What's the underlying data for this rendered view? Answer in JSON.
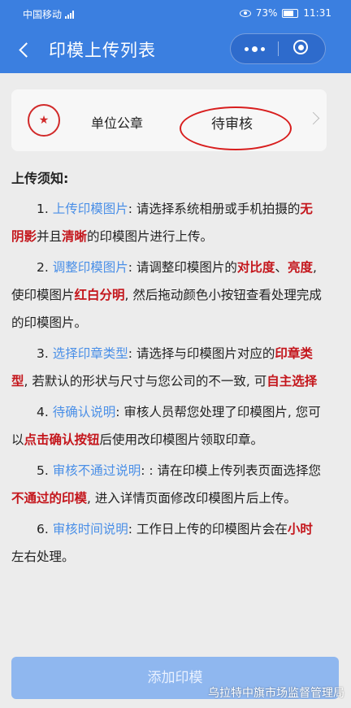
{
  "status_bar": {
    "carrier": "中国移动",
    "battery": "73%",
    "time": "11:31"
  },
  "nav": {
    "title": "印模上传列表"
  },
  "seal_item": {
    "name": "单位公章",
    "status": "待审核"
  },
  "notice": {
    "title": "上传须知:",
    "item1": {
      "num": "1.",
      "head": "上传印模图片",
      "t1": ": 请选择系统相册或手机拍摄的",
      "r1": "无阴影",
      "t2": "并且",
      "r2": "清晰",
      "t3": "的印模图片进行上传。"
    },
    "item2": {
      "num": "2.",
      "head": "调整印模图片",
      "t1": ": 请调整印模图片的",
      "r1": "对比度",
      "t2": "、",
      "r2": "亮度",
      "t3": ", 使印模图片",
      "r3": "红白分明",
      "t4": ", 然后拖动颜色小按钮查看处理完成的印模图片。"
    },
    "item3": {
      "num": "3.",
      "head": "选择印章类型",
      "t1": ": 请选择与印模图片对应的",
      "r1": "印章类型",
      "t2": ", 若默认的形状与尺寸与您公司的不一致, 可",
      "r2": "自主选择"
    },
    "item4": {
      "num": "4.",
      "head": "待确认说明",
      "t1": ": 审核人员帮您处理了印模图片, 您可以",
      "r1": "点击确认按钮",
      "t2": "后使用改印模图片领取印章。"
    },
    "item5": {
      "num": "5.",
      "head": "审核不通过说明",
      "t1": ": : 请在印模上传列表页面选择您",
      "r1": "不通过的印模",
      "t2": ", 进入详情页面修改印模图片后上传。"
    },
    "item6": {
      "num": "6.",
      "head": "审核时间说明",
      "t1": ": 工作日上传的印模图片会在",
      "r1": "小时",
      "t2": "左右处理。"
    }
  },
  "add_button": {
    "label": "添加印模"
  },
  "watermark": "乌拉特中旗市场监督管理局",
  "colors": {
    "primary": "#3b7fe0",
    "link_blue": "#4a8fe7",
    "highlight_red": "#c4161c",
    "button": "#8fb7ef"
  }
}
